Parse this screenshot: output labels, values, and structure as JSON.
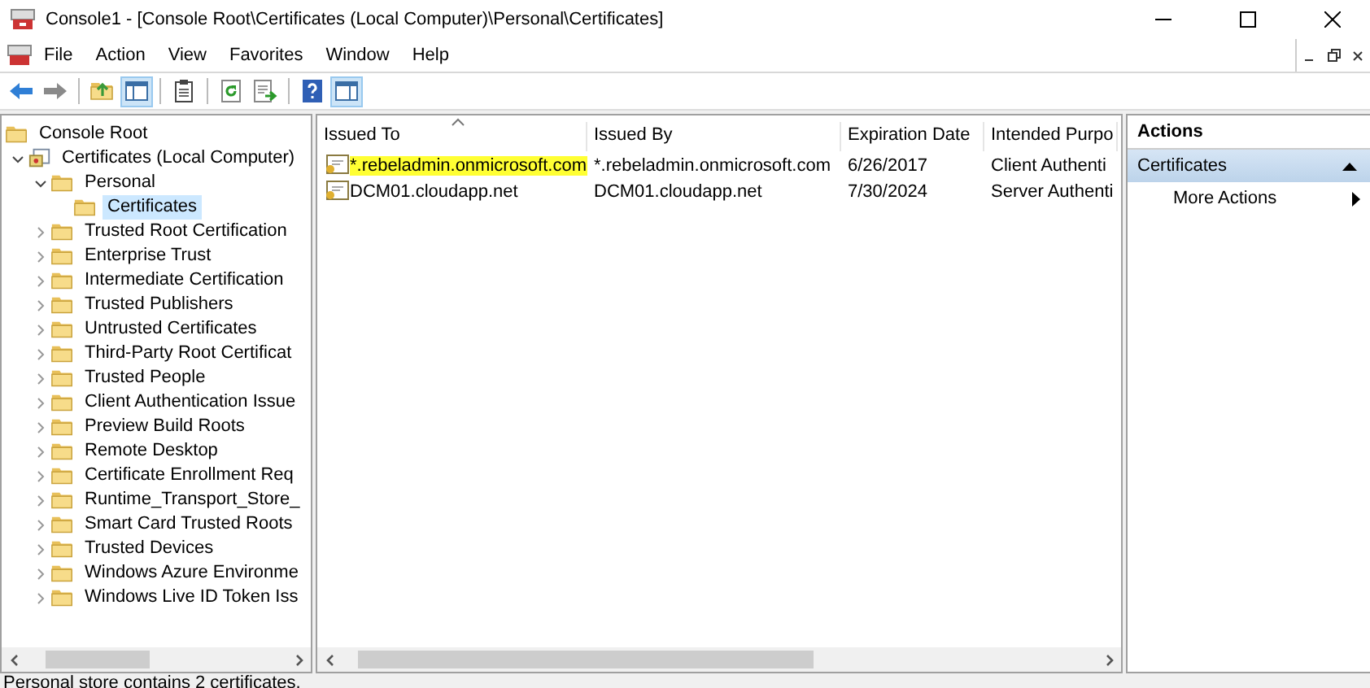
{
  "window": {
    "title": "Console1 - [Console Root\\Certificates (Local Computer)\\Personal\\Certificates]"
  },
  "menu": [
    "File",
    "Action",
    "View",
    "Favorites",
    "Window",
    "Help"
  ],
  "toolbar": [
    {
      "kind": "back",
      "pressed": false
    },
    {
      "kind": "forward",
      "pressed": false
    },
    {
      "kind": "sep"
    },
    {
      "kind": "up",
      "pressed": false
    },
    {
      "kind": "tree",
      "pressed": true
    },
    {
      "kind": "sep"
    },
    {
      "kind": "properties",
      "pressed": false
    },
    {
      "kind": "sep"
    },
    {
      "kind": "refresh",
      "pressed": false
    },
    {
      "kind": "export",
      "pressed": false
    },
    {
      "kind": "sep"
    },
    {
      "kind": "help",
      "pressed": false
    },
    {
      "kind": "actionpane",
      "pressed": true
    }
  ],
  "tree": [
    {
      "label": "Console Root",
      "kind": "folder",
      "selected": false,
      "children": [
        {
          "label": "Certificates (Local Computer)",
          "kind": "snapin",
          "selected": false,
          "expanded": true,
          "children": [
            {
              "label": "Personal",
              "kind": "folder",
              "selected": false,
              "expanded": true,
              "children": [
                {
                  "label": "Certificates",
                  "kind": "folder",
                  "selected": true
                }
              ]
            },
            {
              "label": "Trusted Root Certification",
              "kind": "folder",
              "selected": false,
              "expanded": false
            },
            {
              "label": "Enterprise Trust",
              "kind": "folder",
              "selected": false,
              "expanded": false
            },
            {
              "label": "Intermediate Certification",
              "kind": "folder",
              "selected": false,
              "expanded": false
            },
            {
              "label": "Trusted Publishers",
              "kind": "folder",
              "selected": false,
              "expanded": false
            },
            {
              "label": "Untrusted Certificates",
              "kind": "folder",
              "selected": false,
              "expanded": false
            },
            {
              "label": "Third-Party Root Certificat",
              "kind": "folder",
              "selected": false,
              "expanded": false
            },
            {
              "label": "Trusted People",
              "kind": "folder",
              "selected": false,
              "expanded": false
            },
            {
              "label": "Client Authentication Issue",
              "kind": "folder",
              "selected": false,
              "expanded": false
            },
            {
              "label": "Preview Build Roots",
              "kind": "folder",
              "selected": false,
              "expanded": false
            },
            {
              "label": "Remote Desktop",
              "kind": "folder",
              "selected": false,
              "expanded": false
            },
            {
              "label": "Certificate Enrollment Req",
              "kind": "folder",
              "selected": false,
              "expanded": false
            },
            {
              "label": "Runtime_Transport_Store_",
              "kind": "folder",
              "selected": false,
              "expanded": false
            },
            {
              "label": "Smart Card Trusted Roots",
              "kind": "folder",
              "selected": false,
              "expanded": false
            },
            {
              "label": "Trusted Devices",
              "kind": "folder",
              "selected": false,
              "expanded": false
            },
            {
              "label": "Windows Azure Environme",
              "kind": "folder",
              "selected": false,
              "expanded": false
            },
            {
              "label": "Windows Live ID Token Iss",
              "kind": "folder",
              "selected": false,
              "expanded": false
            }
          ]
        }
      ]
    }
  ],
  "table": {
    "columns": [
      "Issued To",
      "Issued By",
      "Expiration Date",
      "Intended Purpo"
    ],
    "rows": [
      {
        "highlighted": true,
        "cells": [
          "*.rebeladmin.onmicrosoft.com",
          "*.rebeladmin.onmicrosoft.com",
          "6/26/2017",
          "Client Authenti"
        ]
      },
      {
        "highlighted": false,
        "cells": [
          "DCM01.cloudapp.net",
          "DCM01.cloudapp.net",
          "7/30/2024",
          "Server Authenti"
        ]
      }
    ]
  },
  "actions": {
    "title": "Actions",
    "section": "Certificates",
    "items": [
      "More Actions"
    ]
  },
  "status_bar": "Personal store contains 2 certificates."
}
